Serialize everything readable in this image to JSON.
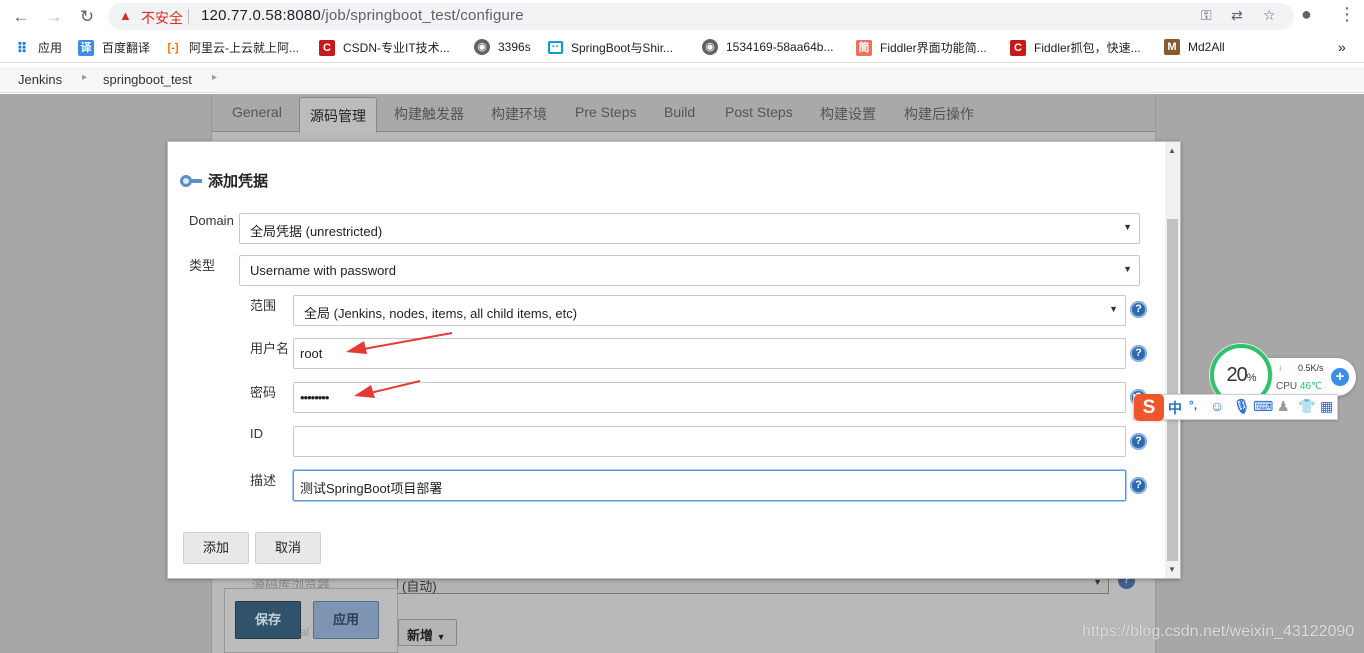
{
  "browser": {
    "security_label": "不安全",
    "url_host": "120.77.0.58:8080",
    "url_path": "/job/springboot_test/configure",
    "bookmarks": [
      {
        "icon": "apps-grid-icon",
        "label": "应用"
      },
      {
        "icon": "translate-icon",
        "label": "百度翻译"
      },
      {
        "icon": "aliyun-icon",
        "label": "阿里云-上云就上阿..."
      },
      {
        "icon": "csdn-icon",
        "label": "CSDN-专业IT技术..."
      },
      {
        "icon": "globe-icon",
        "label": "3396s"
      },
      {
        "icon": "bilibili-icon",
        "label": "SpringBoot与Shir..."
      },
      {
        "icon": "globe-icon",
        "label": "1534169-58aa64b..."
      },
      {
        "icon": "jian-icon",
        "label": "Fiddler界面功能简..."
      },
      {
        "icon": "csdn-icon",
        "label": "Fiddler抓包，快速..."
      },
      {
        "icon": "md2all-icon",
        "label": "Md2All"
      }
    ],
    "more": "»"
  },
  "breadcrumb": [
    "Jenkins",
    "springboot_test"
  ],
  "config_tabs": [
    {
      "label": "General",
      "active": false
    },
    {
      "label": "源码管理",
      "active": true
    },
    {
      "label": "构建触发器",
      "active": false
    },
    {
      "label": "构建环境",
      "active": false
    },
    {
      "label": "Pre Steps",
      "active": false
    },
    {
      "label": "Build",
      "active": false
    },
    {
      "label": "Post Steps",
      "active": false
    },
    {
      "label": "构建设置",
      "active": false
    },
    {
      "label": "构建后操作",
      "active": false
    }
  ],
  "background_form": {
    "browser_label": "源码库浏览器",
    "browser_value": "(自动)",
    "save": "保存",
    "apply": "应用",
    "add": "新增",
    "partial_label": "al"
  },
  "dialog": {
    "title": "添加凭据",
    "domain_label": "Domain",
    "domain_value": "全局凭据 (unrestricted)",
    "kind_label": "类型",
    "kind_value": "Username with password",
    "scope_label": "范围",
    "scope_value": "全局 (Jenkins, nodes, items, all child items, etc)",
    "username_label": "用户名",
    "username_value": "root",
    "password_label": "密码",
    "password_value": "••••••••",
    "id_label": "ID",
    "id_value": "",
    "description_label": "描述",
    "description_value": "测试SpringBoot项目部署",
    "add_button": "添加",
    "cancel_button": "取消",
    "help_glyph": "?"
  },
  "net_widget": {
    "percent": "20",
    "percent_unit": "%",
    "speed": "0.5K/s",
    "cpu_label": "CPU",
    "cpu_temp": "46℃"
  },
  "ime_bar": {
    "logo": "S",
    "mode": "中",
    "punct": "°,"
  },
  "watermark": "https://blog.csdn.net/weixin_43122090",
  "colors": {
    "accent_red": "#d93025",
    "help_blue": "#2e69b0",
    "arrow_red": "#e53935"
  }
}
